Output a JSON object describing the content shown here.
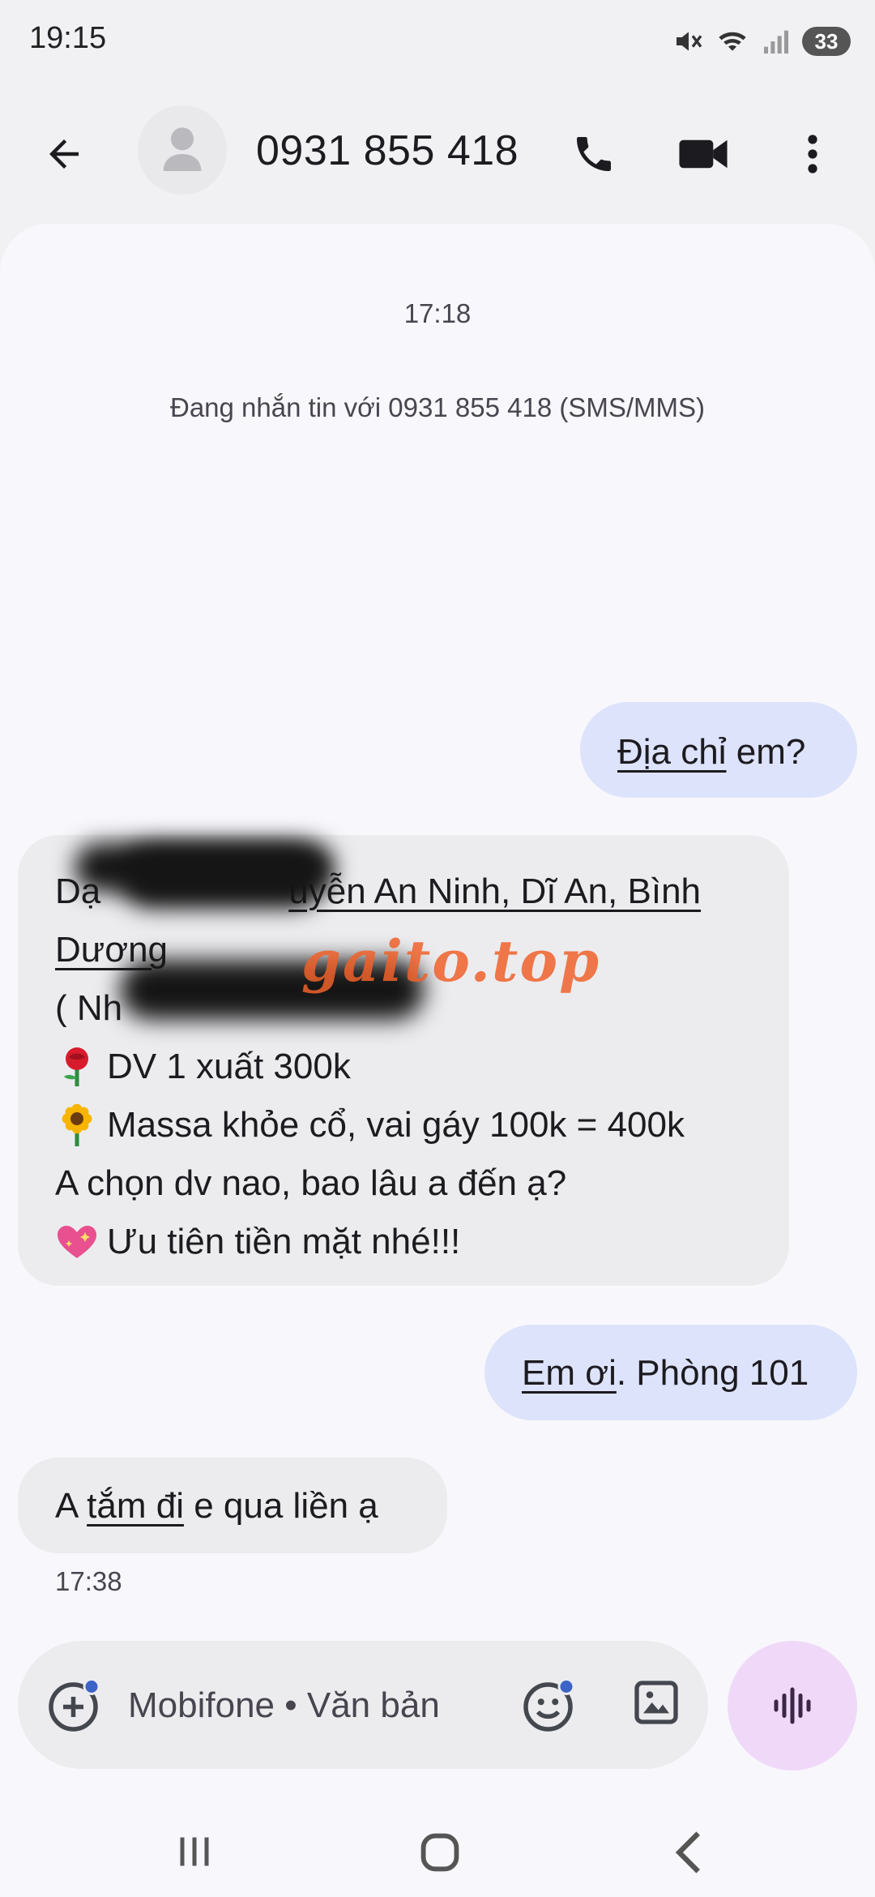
{
  "status_bar": {
    "time": "19:15",
    "battery": "33",
    "icons": [
      "mute-icon",
      "wifi-icon",
      "signal-icon",
      "battery-icon"
    ]
  },
  "header": {
    "contact": "0931 855 418",
    "icons": [
      "back-arrow-icon",
      "avatar-person-icon",
      "phone-icon",
      "video-call-icon",
      "more-vert-icon"
    ]
  },
  "conversation": {
    "timestamp_top": "17:18",
    "info": "Đang nhắn tin với 0931 855 418 (SMS/MMS)",
    "messages": [
      {
        "direction": "outgoing",
        "parts": {
          "underlined": "Địa chỉ",
          "rest": " em?"
        }
      },
      {
        "direction": "incoming",
        "lines": [
          {
            "start": "Dạ",
            "underlined": "uyễn An Ninh, Dĩ An, Bình"
          },
          {
            "underlined": "Dương"
          },
          {
            "text": "( Nh"
          },
          {
            "emoji": "rose-icon",
            "text": "DV 1 xuất 300k"
          },
          {
            "emoji": "sunflower-icon",
            "text": "Massa khỏe cổ, vai gáy 100k = 400k"
          },
          {
            "text": "A chọn dv nao, bao lâu a đến ạ?"
          },
          {
            "emoji": "sparkling-heart-icon",
            "text": "Ưu tiên tiền mặt nhé!!!"
          }
        ]
      },
      {
        "direction": "outgoing",
        "parts": {
          "underlined": "Em ơi",
          "rest": ". Phòng 101"
        }
      },
      {
        "direction": "incoming",
        "parts": {
          "start": "A ",
          "underlined": "tắm đi",
          "rest": " e qua liền ạ"
        }
      }
    ],
    "timestamp_bottom": "17:38",
    "watermark": "gaito.top"
  },
  "compose": {
    "placeholder": "Mobifone • Văn bản",
    "icons": [
      "add-attachment-icon",
      "emoji-icon",
      "gallery-icon",
      "voice-waveform-icon"
    ]
  },
  "colors": {
    "outgoing_bubble": "#dde3fb",
    "incoming_bubble": "#ececef",
    "voice_button": "#f0d9f8",
    "watermark": "#ee622a"
  }
}
